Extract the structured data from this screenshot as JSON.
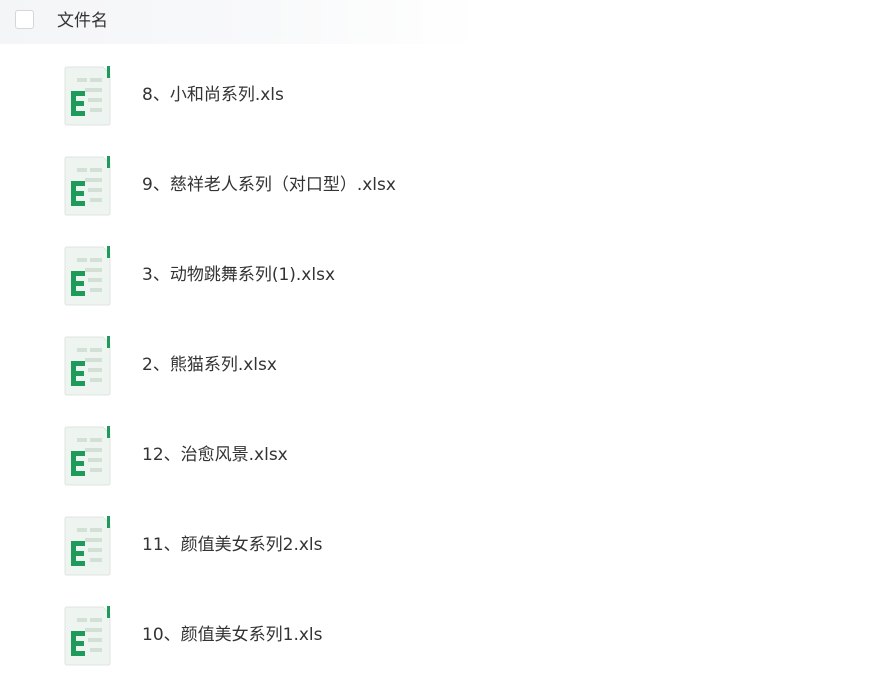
{
  "header": {
    "column_label": "文件名"
  },
  "files": [
    {
      "name": "8、小和尚系列.xls",
      "icon": "excel-file-icon"
    },
    {
      "name": "9、慈祥老人系列（对口型）.xlsx",
      "icon": "excel-file-icon"
    },
    {
      "name": "3、动物跳舞系列(1).xlsx",
      "icon": "excel-file-icon"
    },
    {
      "name": "2、熊猫系列.xlsx",
      "icon": "excel-file-icon"
    },
    {
      "name": "12、治愈风景.xlsx",
      "icon": "excel-file-icon"
    },
    {
      "name": "11、颜值美女系列2.xls",
      "icon": "excel-file-icon"
    },
    {
      "name": "10、颜值美女系列1.xls",
      "icon": "excel-file-icon"
    }
  ],
  "colors": {
    "excel_green": "#1e9b5a",
    "text": "#333333"
  }
}
